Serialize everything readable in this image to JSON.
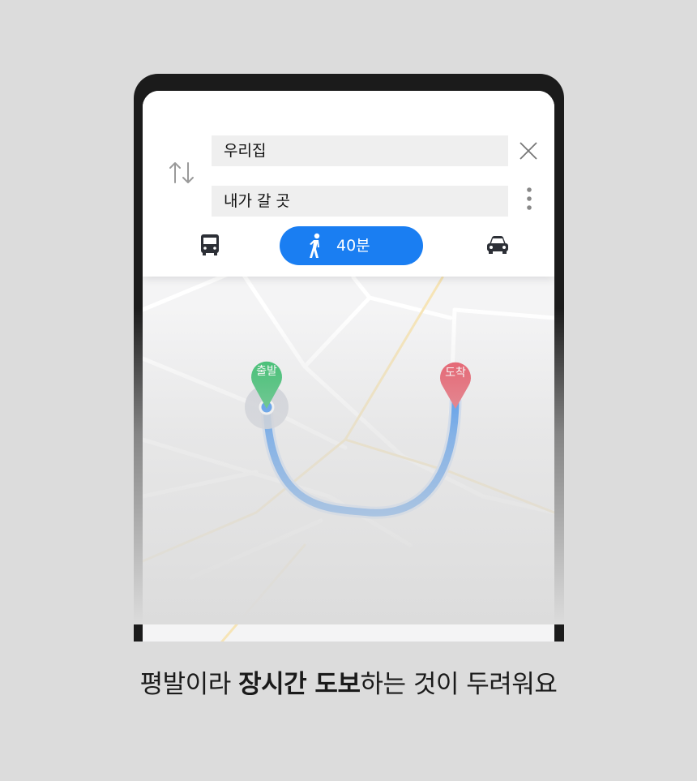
{
  "route": {
    "from_value": "우리집",
    "to_value": "내가 갈 곳"
  },
  "modes": {
    "walk_time": "40분",
    "active": "walk"
  },
  "markers": {
    "start_label": "출발",
    "end_label": "도착"
  },
  "caption": {
    "part1": "평발이라 ",
    "bold": "장시간 도보",
    "part2": "하는 것이  두려워요"
  },
  "icons": {
    "swap": "swap-arrows-icon",
    "close": "close-icon",
    "more": "more-vertical-icon",
    "bus": "bus-icon",
    "walk": "walk-icon",
    "car": "car-icon"
  },
  "colors": {
    "accent": "#1a7ef2",
    "start_marker": "#1fb85b",
    "end_marker": "#e84657",
    "route": "#1a7ef2",
    "background": "#dcdcdc",
    "phone_frame": "#1b1b1b"
  }
}
